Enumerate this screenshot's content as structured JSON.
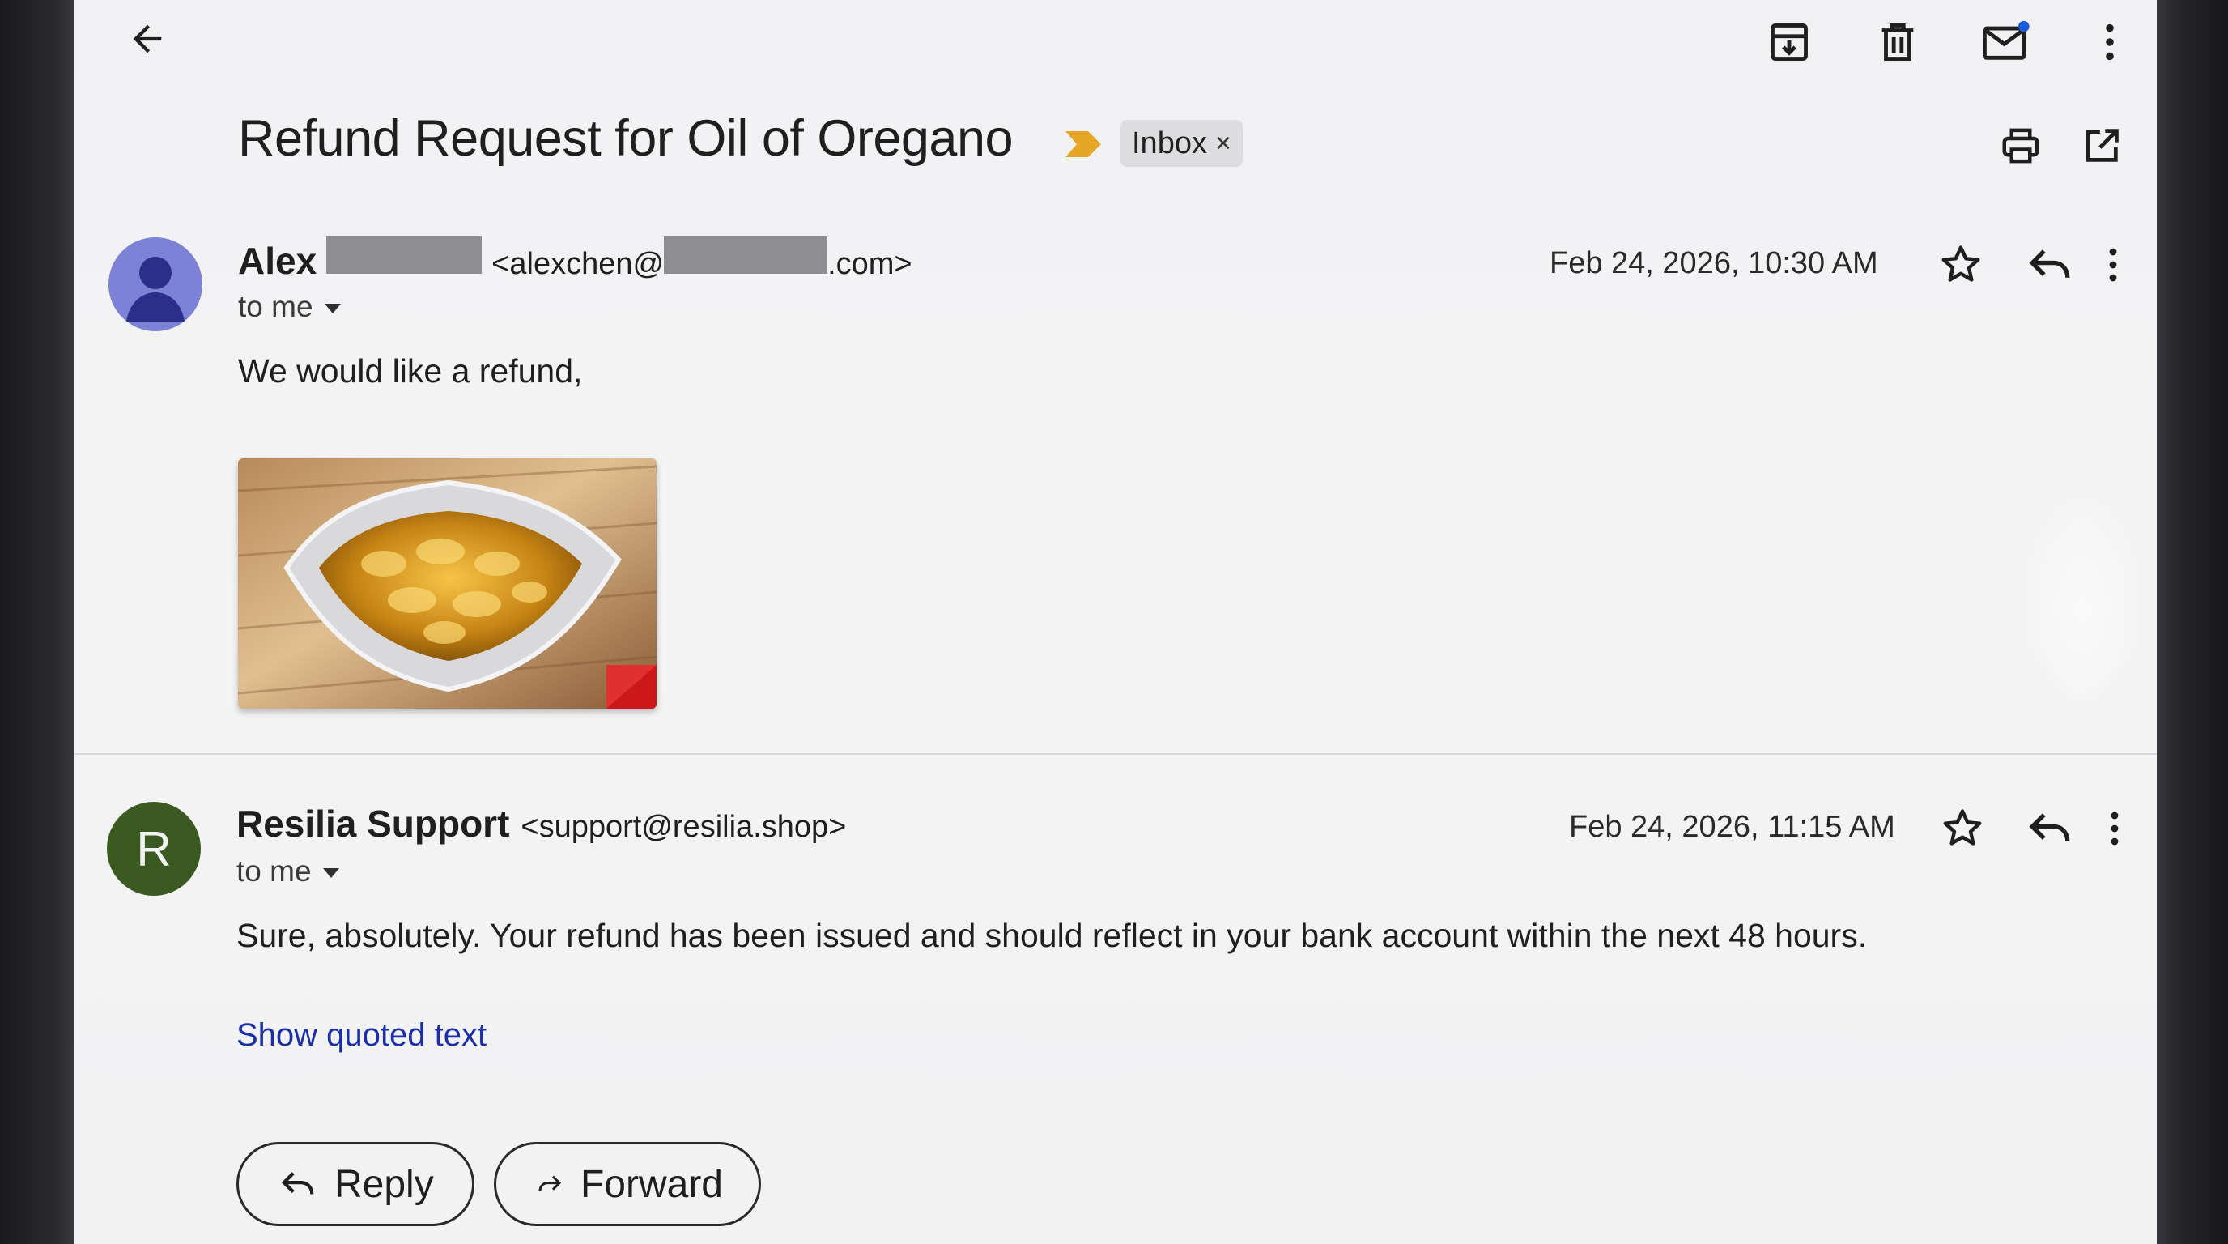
{
  "toolbar": {
    "back_icon": "arrow-left-icon",
    "archive_icon": "archive-icon",
    "delete_icon": "trash-icon",
    "mark_unread_icon": "mail-unread-icon",
    "more_icon": "more-vert-icon",
    "print_icon": "print-icon",
    "open_new_window_icon": "open-in-new-icon"
  },
  "thread": {
    "subject": "Refund Request for Oil of Oregano",
    "importance_marker_color": "#e6a726",
    "label": "Inbox",
    "label_remove": "×"
  },
  "messages": [
    {
      "sender_name": "Alex",
      "sender_email_prefix": "<alexchen@",
      "sender_email_suffix": ".com>",
      "to_line": "to me",
      "date": "Feb 24, 2026, 10:30 AM",
      "body": "We would like a refund,",
      "attachment": "oil-of-oregano-softgels-photo",
      "avatar_icon": "person-avatar-icon",
      "avatar_color": "#7c83d6"
    },
    {
      "sender_name": "Resilia Support",
      "sender_email": "<support@resilia.shop>",
      "avatar_letter": "R",
      "avatar_color": "#3b5a22",
      "to_line": "to me",
      "date": "Feb 24, 2026, 11:15 AM",
      "body": "Sure, absolutely. Your refund has been issued and should reflect in your bank account within the next 48 hours.",
      "show_quoted": "Show quoted text"
    }
  ],
  "actions": {
    "reply_label": "Reply",
    "forward_label": "Forward"
  }
}
